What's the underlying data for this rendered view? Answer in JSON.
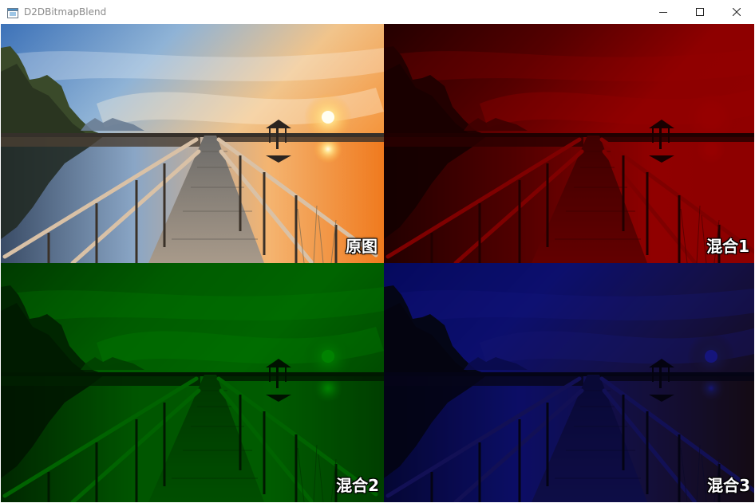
{
  "window": {
    "title": "D2DBitmapBlend",
    "app_icon": "app-window-icon",
    "controls": {
      "minimize_icon": "minimize-icon",
      "maximize_icon": "maximize-icon",
      "close_icon": "close-icon"
    }
  },
  "panels": [
    {
      "label": "原图",
      "blend": "none",
      "image": "boardwalk-sunset-photo"
    },
    {
      "label": "混合1",
      "blend": "red",
      "tint_color": "#b80000",
      "image": "boardwalk-sunset-photo"
    },
    {
      "label": "混合2",
      "blend": "green",
      "tint_color": "#00a000",
      "image": "boardwalk-sunset-photo"
    },
    {
      "label": "混合3",
      "blend": "blue",
      "tint_color": "#1a1aa0",
      "image": "boardwalk-sunset-photo"
    }
  ]
}
